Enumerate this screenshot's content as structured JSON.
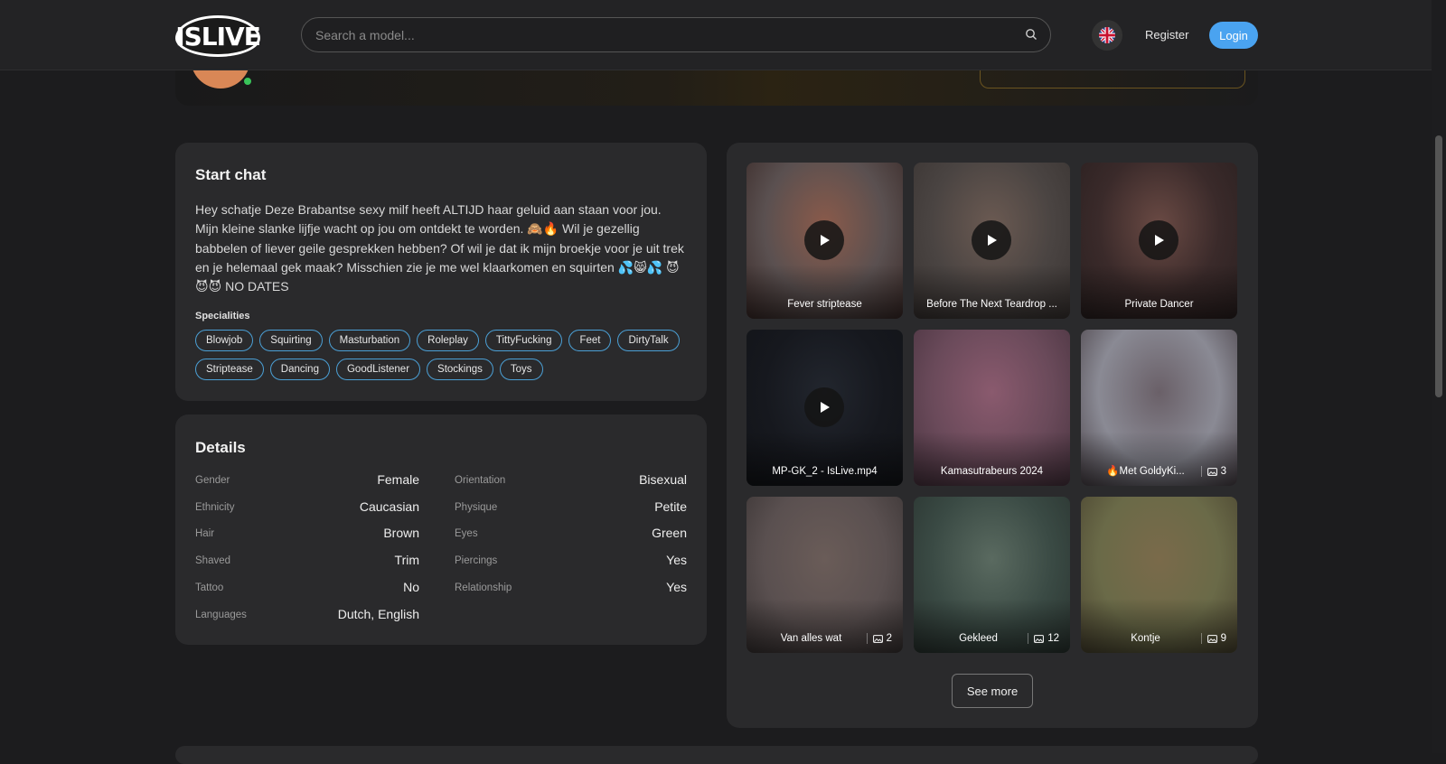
{
  "header": {
    "logo_text": "ISLIVE",
    "search_placeholder": "Search a model...",
    "language": "English",
    "register_label": "Register",
    "login_label": "Login",
    "login_color": "#4aa3f0"
  },
  "start_chat": {
    "title": "Start chat",
    "bio": "Hey schatje Deze Brabantse sexy milf heeft ALTIJD haar geluid aan staan voor jou. Mijn kleine slanke lijfje wacht op jou om ontdekt te worden. 🙈🔥 Wil je gezellig babbelen of liever geile gesprekken hebben? Of wil je dat ik mijn broekje voor je uit trek en je helemaal gek maak? Misschien zie je me wel klaarkomen en squirten 💦😸💦 😈😈😈 NO DATES",
    "specialities_title": "Specialities",
    "specialities": [
      "Blowjob",
      "Squirting",
      "Masturbation",
      "Roleplay",
      "TittyFucking",
      "Feet",
      "DirtyTalk",
      "Striptease",
      "Dancing",
      "GoodListener",
      "Stockings",
      "Toys"
    ]
  },
  "details": {
    "title": "Details",
    "left": [
      {
        "label": "Gender",
        "value": "Female"
      },
      {
        "label": "Ethnicity",
        "value": "Caucasian"
      },
      {
        "label": "Hair",
        "value": "Brown"
      },
      {
        "label": "Shaved",
        "value": "Trim"
      },
      {
        "label": "Tattoo",
        "value": "No"
      },
      {
        "label": "Languages",
        "value": "Dutch, English"
      }
    ],
    "right": [
      {
        "label": "Orientation",
        "value": "Bisexual"
      },
      {
        "label": "Physique",
        "value": "Petite"
      },
      {
        "label": "Eyes",
        "value": "Green"
      },
      {
        "label": "Piercings",
        "value": "Yes"
      },
      {
        "label": "Relationship",
        "value": "Yes"
      }
    ]
  },
  "gallery": {
    "items": [
      {
        "title": "Fever striptease",
        "type": "video",
        "colors": [
          "#5a5050",
          "#8a5a4a",
          "#3a2a28"
        ]
      },
      {
        "title": "Before The Next Teardrop ...",
        "type": "video",
        "colors": [
          "#4a4442",
          "#6b5a52",
          "#3a3432"
        ]
      },
      {
        "title": "Private Dancer",
        "type": "video",
        "colors": [
          "#3a2a2a",
          "#6a4a44",
          "#2a2020"
        ]
      },
      {
        "title": "MP-GK_2 - IsLive.mp4",
        "type": "video",
        "colors": [
          "#16181e",
          "#22262e",
          "#121418"
        ]
      },
      {
        "title": "Kamasutrabeurs 2024",
        "type": "album",
        "colors": [
          "#6a4a5a",
          "#8a5a6e",
          "#4a3440"
        ]
      },
      {
        "title": "🔥Met GoldyKi...",
        "type": "album",
        "count": "3",
        "colors": [
          "#8a8a94",
          "#6a6068",
          "#4a4248"
        ]
      },
      {
        "title": "Van alles wat",
        "type": "album",
        "count": "2",
        "colors": [
          "#5a5050",
          "#6a5c58",
          "#3a3434"
        ]
      },
      {
        "title": "Gekleed",
        "type": "album",
        "count": "12",
        "colors": [
          "#3a4a44",
          "#5a6a60",
          "#2a3430"
        ]
      },
      {
        "title": "Kontje",
        "type": "album",
        "count": "9",
        "colors": [
          "#6a6a48",
          "#7a6a4a",
          "#4a4430"
        ]
      }
    ],
    "see_more_label": "See more"
  }
}
